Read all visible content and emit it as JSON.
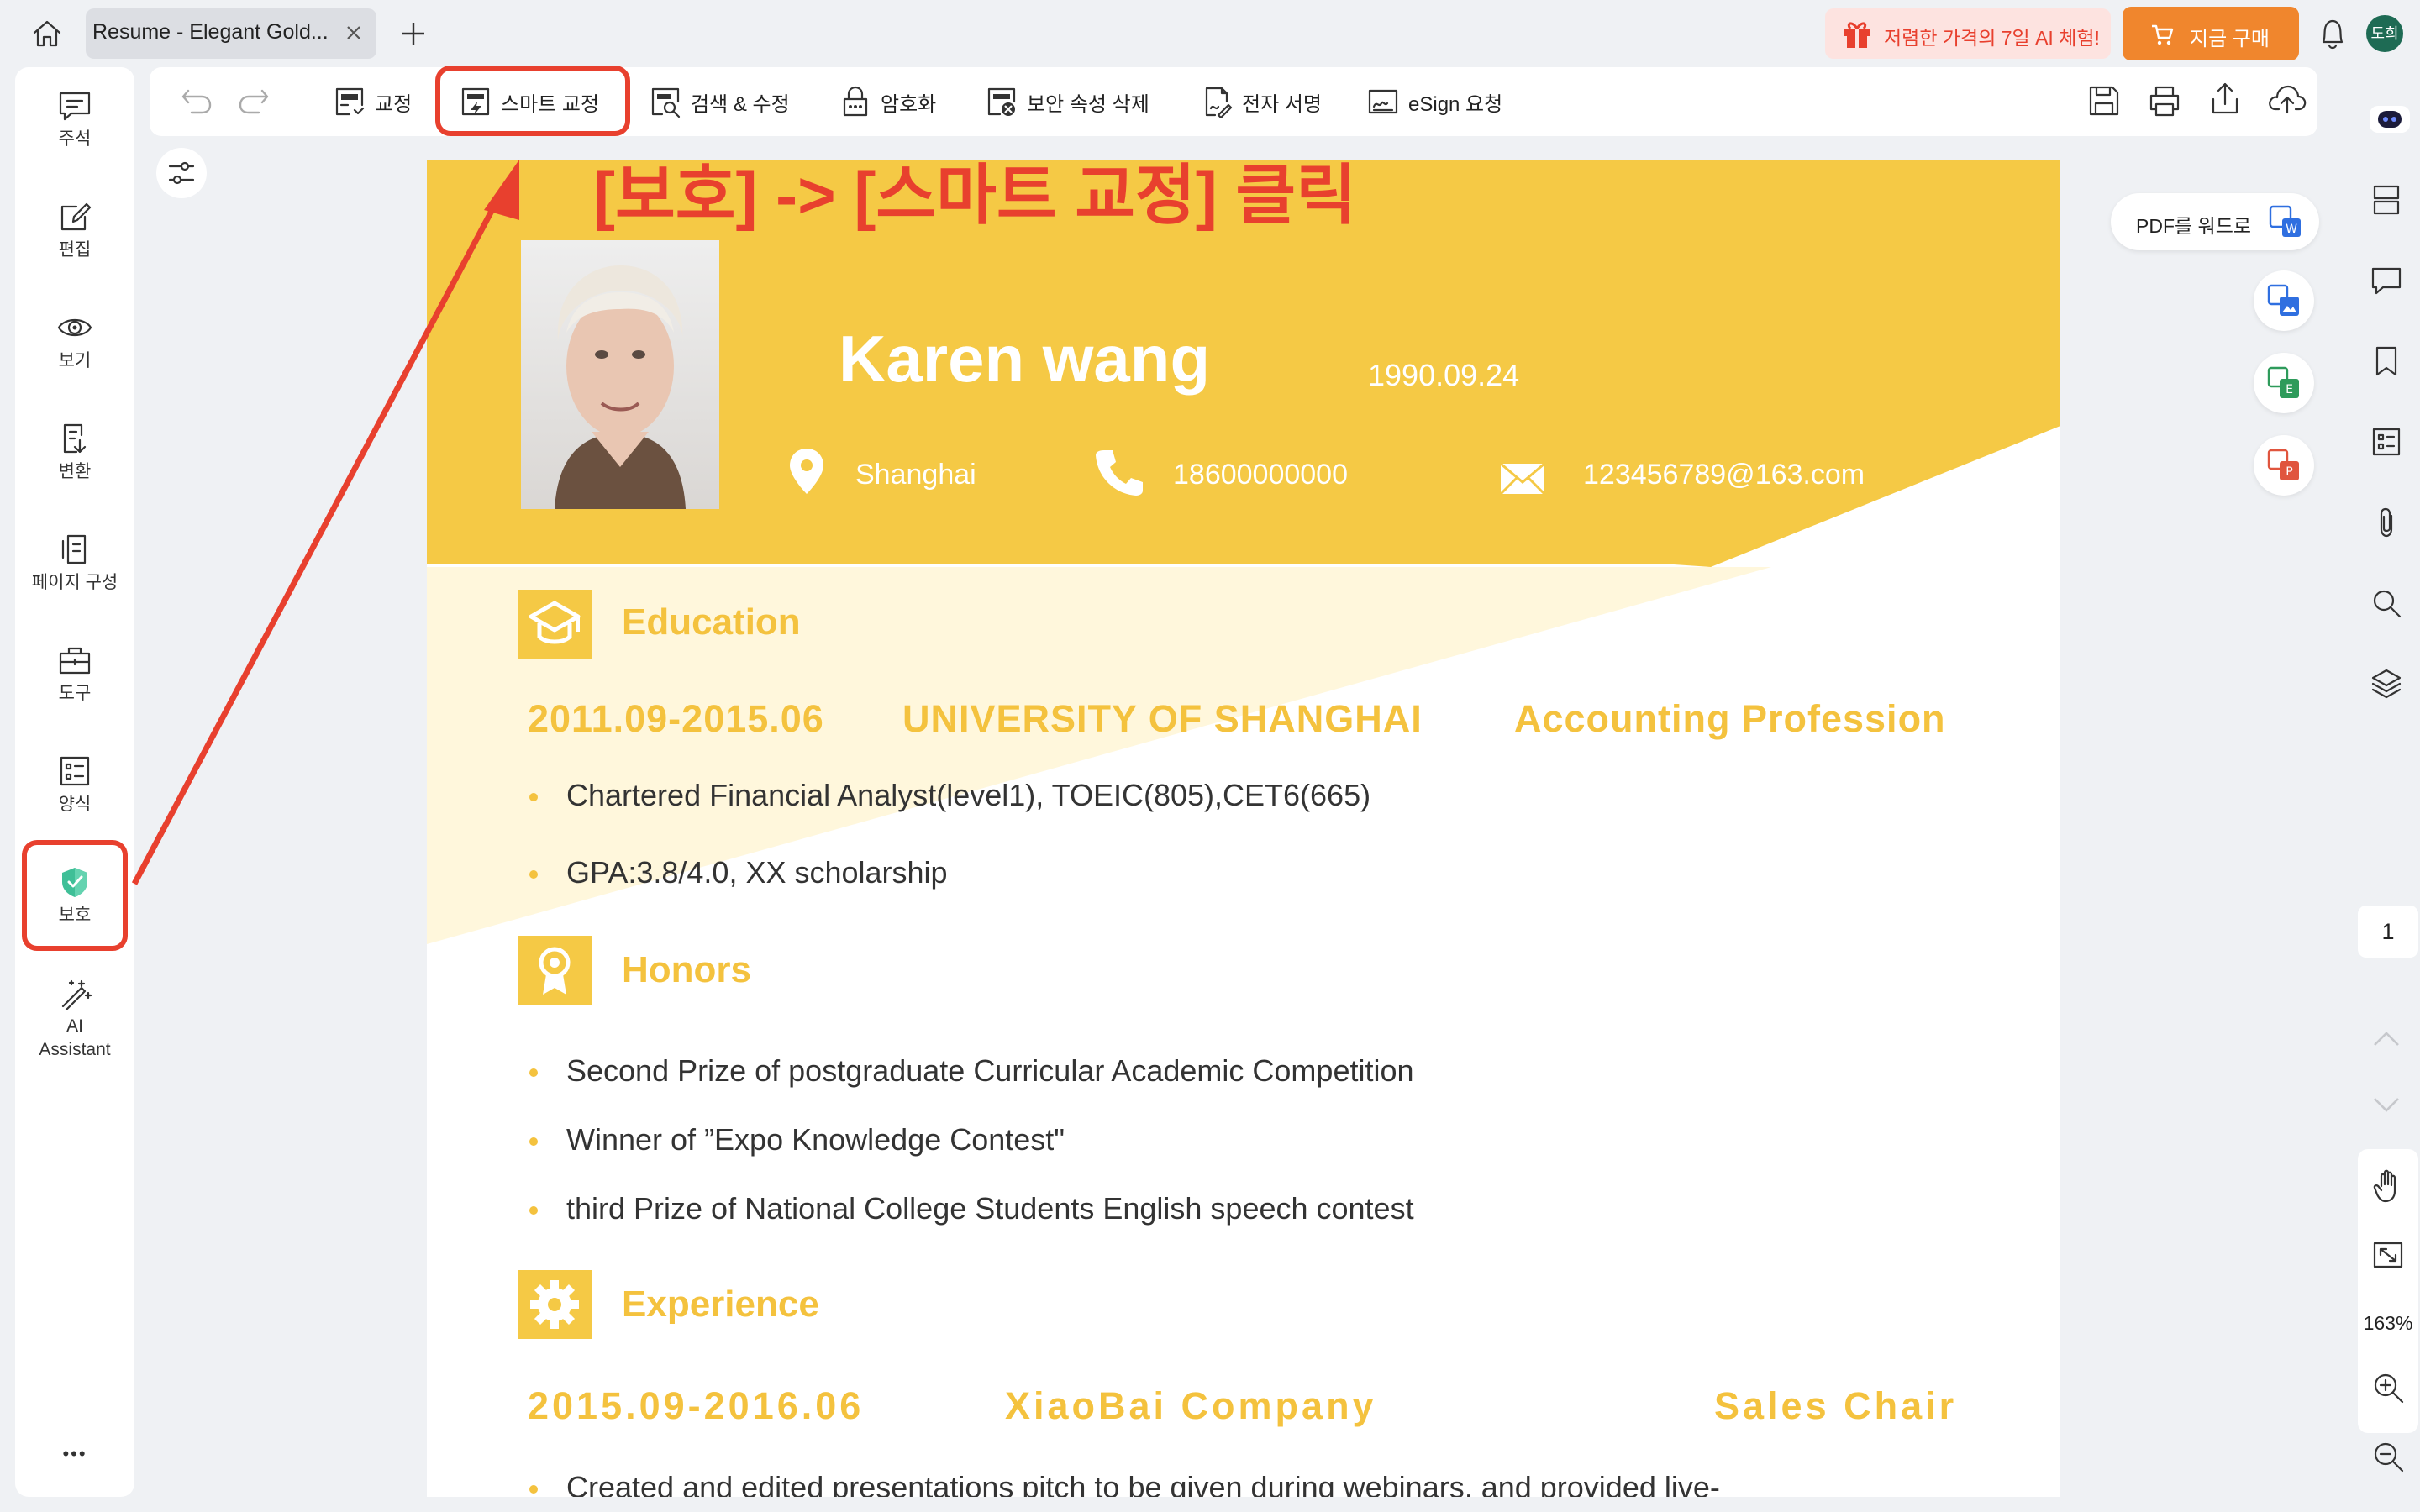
{
  "tab": {
    "title": "Resume - Elegant Gold..."
  },
  "promo": {
    "text": "저렴한 가격의 7일 AI 체험!",
    "buy_label": "지금 구매"
  },
  "user": {
    "initials": "도희"
  },
  "sidebar": {
    "items": [
      {
        "label": "주석"
      },
      {
        "label": "편집"
      },
      {
        "label": "보기"
      },
      {
        "label": "변환"
      },
      {
        "label": "페이지 구성"
      },
      {
        "label": "도구"
      },
      {
        "label": "양식"
      },
      {
        "label": "보호"
      },
      {
        "label": "AI"
      },
      {
        "label": "Assistant"
      }
    ],
    "more": "•••"
  },
  "toolbar": {
    "items": [
      {
        "label": "교정"
      },
      {
        "label": "스마트 교정"
      },
      {
        "label": "검색 & 수정"
      },
      {
        "label": "암호화"
      },
      {
        "label": "보안 속성 삭제"
      },
      {
        "label": "전자 서명"
      },
      {
        "label": "eSign 요청"
      }
    ]
  },
  "annotation": {
    "text": "[보호] -> [스마트 교정] 클릭"
  },
  "resume": {
    "name": "Karen wang",
    "birth": "1990.09.24",
    "city": "Shanghai",
    "phone": "18600000000",
    "email": "123456789@163.com",
    "education": {
      "title": "Education",
      "period": "2011.09-2015.06",
      "school": "UNIVERSITY OF SHANGHAI",
      "major": "Accounting Profession",
      "bullets": [
        "Chartered Financial Analyst(level1), TOEIC(805),CET6(665)",
        "GPA:3.8/4.0, XX scholarship"
      ]
    },
    "honors": {
      "title": "Honors",
      "bullets": [
        "Second Prize of postgraduate Curricular Academic Competition",
        "Winner of ”Expo Knowledge Contest\"",
        "third Prize of National College Students English speech contest"
      ]
    },
    "experience": {
      "title": "Experience",
      "period": "2015.09-2016.06",
      "company": "XiaoBai Company",
      "role": "Sales Chair",
      "bullets": [
        "Created and edited presentations pitch to be given during webinars, and provided live-"
      ]
    }
  },
  "right_panel": {
    "pdf_to_word": "PDF를 워드로",
    "page_number": "1",
    "zoom": "163%"
  },
  "colors": {
    "accent_yellow": "#f5c945",
    "highlight_red": "#e8402e",
    "promo_orange": "#f0862d"
  }
}
